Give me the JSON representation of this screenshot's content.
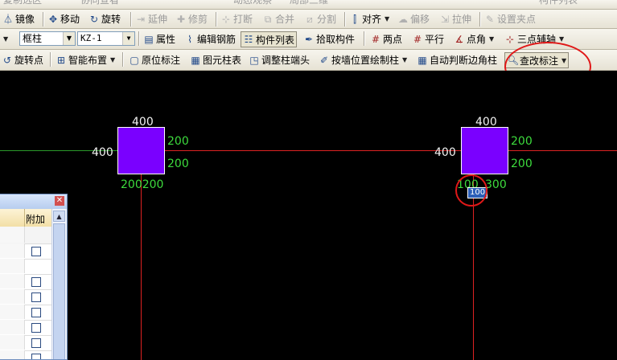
{
  "toolbar_row0": {
    "items": [
      "复制选区",
      "协同查看",
      "动态观察",
      "局部三维",
      "查找",
      "图元属性",
      "批量选择",
      "构件列表"
    ]
  },
  "toolbar_row1": {
    "mirror": "镜像",
    "move": "移动",
    "rotate": "旋转",
    "extend": "延伸",
    "trim": "修剪",
    "break": "打断",
    "merge": "合并",
    "split": "分割",
    "align": "对齐",
    "offset": "偏移",
    "stretch": "拉伸",
    "set_grip": "设置夹点"
  },
  "toolbar_row2": {
    "type_combo": "框柱",
    "name_combo": "KZ-1",
    "properties": "属性",
    "edit_rebar": "编辑钢筋",
    "component_list": "构件列表",
    "pick_component": "拾取构件",
    "two_points": "两点",
    "parallel": "平行",
    "point_angle": "点角",
    "three_point_aux": "三点辅轴"
  },
  "toolbar_row3": {
    "rotate_point": "旋转点",
    "smart_layout": "智能布置",
    "in_place_dim": "原位标注",
    "element_col_table": "图元柱表",
    "adjust_col_end": "调整柱端头",
    "draw_by_wall": "按墙位置绘制柱",
    "auto_edge_col": "自动判断边角柱",
    "check_dim": "查改标注"
  },
  "canvas": {
    "column_left": {
      "top_dim": "400",
      "left_dim": "400",
      "right_dim_1": "200",
      "right_dim_2": "200",
      "bottom_dim": "200200"
    },
    "column_right": {
      "top_dim": "400",
      "left_dim": "400",
      "right_dim_1": "200",
      "right_dim_2": "200",
      "bottom_dim_left": "100",
      "bottom_dim_right": "300",
      "edit_tag": "100"
    }
  },
  "panel": {
    "close": "✕",
    "header_label": "附加",
    "scroll_up": "▲"
  }
}
